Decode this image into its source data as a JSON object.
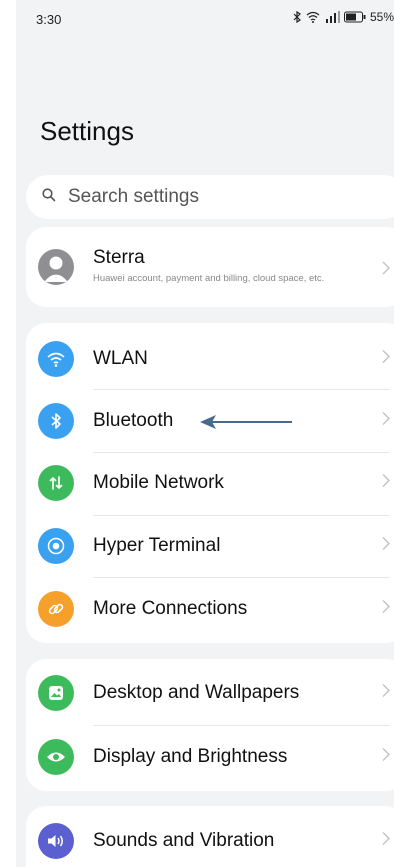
{
  "status_bar": {
    "time": "3:30",
    "battery": "55%",
    "icons": [
      "bluetooth-icon",
      "wifi-icon",
      "signal-icon",
      "battery-icon"
    ]
  },
  "page": {
    "title": "Settings"
  },
  "search": {
    "placeholder": "Search settings"
  },
  "account": {
    "name": "Sterra",
    "subtitle": "Huawei account, payment and billing, cloud space, etc."
  },
  "connectivity": [
    {
      "label": "WLAN",
      "icon": "wifi-icon",
      "color": "#3aa0f0"
    },
    {
      "label": "Bluetooth",
      "icon": "bluetooth-icon",
      "color": "#3aa0f0"
    },
    {
      "label": "Mobile Network",
      "icon": "mobile-network-icon",
      "color": "#3dba5c"
    },
    {
      "label": "Hyper Terminal",
      "icon": "hyper-terminal-icon",
      "color": "#3aa0f0"
    },
    {
      "label": "More Connections",
      "icon": "link-icon",
      "color": "#f5a02a"
    }
  ],
  "display": [
    {
      "label": "Desktop and Wallpapers",
      "icon": "wallpaper-icon",
      "color": "#3dba5c"
    },
    {
      "label": "Display and Brightness",
      "icon": "eye-icon",
      "color": "#3dba5c"
    }
  ],
  "sound": [
    {
      "label": "Sounds and Vibration",
      "icon": "speaker-icon",
      "color": "#5b5fcf"
    }
  ],
  "annotation": {
    "arrow_color": "#4a6a8c"
  }
}
